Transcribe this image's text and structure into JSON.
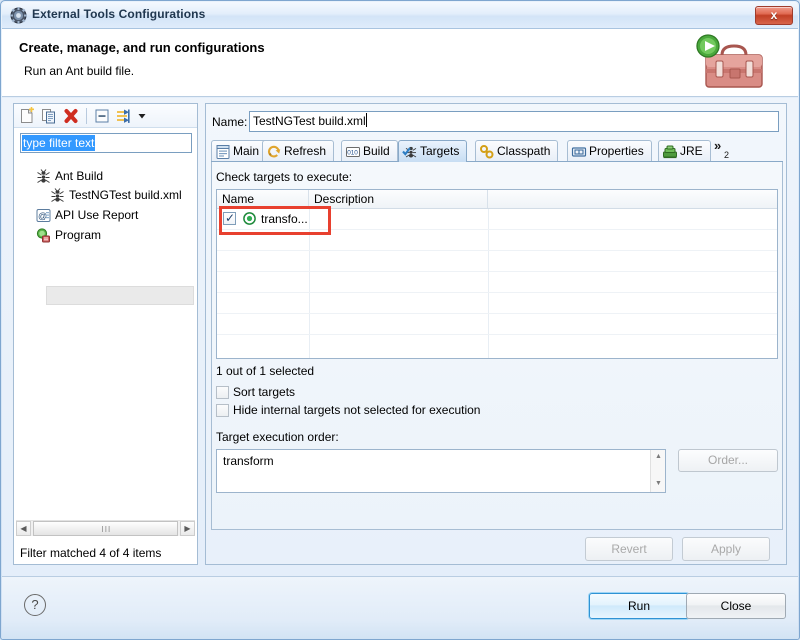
{
  "window": {
    "title": "External Tools Configurations",
    "title_icon": "gear-icon",
    "close_label": "x"
  },
  "banner": {
    "title": "Create, manage, and run configurations",
    "subtitle": "Run an Ant build file.",
    "art_icon": "toolbox-with-run-icon"
  },
  "left_panel": {
    "toolbar": [
      {
        "name": "new-configuration-icon",
        "label": "New"
      },
      {
        "name": "duplicate-configuration-icon",
        "label": "Duplicate"
      },
      {
        "name": "delete-configuration-icon",
        "label": "Delete"
      },
      {
        "name": "collapse-all-icon",
        "label": "Collapse All"
      },
      {
        "name": "filter-icon",
        "label": "Filter"
      },
      {
        "name": "chevron-down-icon",
        "label": "Menu"
      }
    ],
    "filter": {
      "value": "type filter text",
      "placeholder": "type filter text",
      "selected": true
    },
    "tree": [
      {
        "label": "Ant Build",
        "icon": "ant-icon",
        "indent": 0,
        "selected": false
      },
      {
        "label": "TestNGTest build.xml",
        "icon": "ant-icon",
        "indent": 1,
        "selected": true
      },
      {
        "label": "API Use Report",
        "icon": "api-use-report-icon",
        "indent": 0,
        "selected": false
      },
      {
        "label": "Program",
        "icon": "program-icon",
        "indent": 0,
        "selected": false
      }
    ],
    "status": "Filter matched 4 of 4 items",
    "scrollbar": {
      "left_arrow": "◀",
      "right_arrow": "▶",
      "grip": "III"
    }
  },
  "right_panel": {
    "name_label": "Name:",
    "name_value": "TestNGTest build.xml",
    "tabs": [
      {
        "label": "Main",
        "icon": "main-tab-icon",
        "active": false
      },
      {
        "label": "Refresh",
        "icon": "refresh-tab-icon",
        "active": false
      },
      {
        "label": "Build",
        "icon": "build-tab-icon",
        "active": false
      },
      {
        "label": "Targets",
        "icon": "targets-tab-icon",
        "active": true
      },
      {
        "label": "Classpath",
        "icon": "classpath-tab-icon",
        "active": false
      },
      {
        "label": "Properties",
        "icon": "properties-tab-icon",
        "active": false
      },
      {
        "label": "JRE",
        "icon": "jre-tab-icon",
        "active": false
      }
    ],
    "tab_overflow": {
      "label": "»",
      "count": "2"
    },
    "targets": {
      "instruction": "Check targets to execute:",
      "columns": [
        "Name",
        "Description"
      ],
      "rows": [
        {
          "checked": true,
          "name": "transfo...",
          "description": "",
          "icon": "target-icon"
        }
      ],
      "selection_info": "1 out of 1 selected",
      "options": [
        {
          "label": "Sort targets",
          "checked": false
        },
        {
          "label": "Hide internal targets not selected for execution",
          "checked": false
        }
      ],
      "order_label": "Target execution order:",
      "order_value": "transform",
      "order_button": "Order...",
      "highlight_color": "#e8402f"
    },
    "revert_button": "Revert",
    "apply_button": "Apply"
  },
  "footer": {
    "help_icon": "?",
    "run_button": "Run",
    "close_button": "Close"
  },
  "colors": {
    "accent": "#2f93d4",
    "highlight": "#e8402f",
    "selection": "#3399ff",
    "active_tab": "#c7def3"
  }
}
